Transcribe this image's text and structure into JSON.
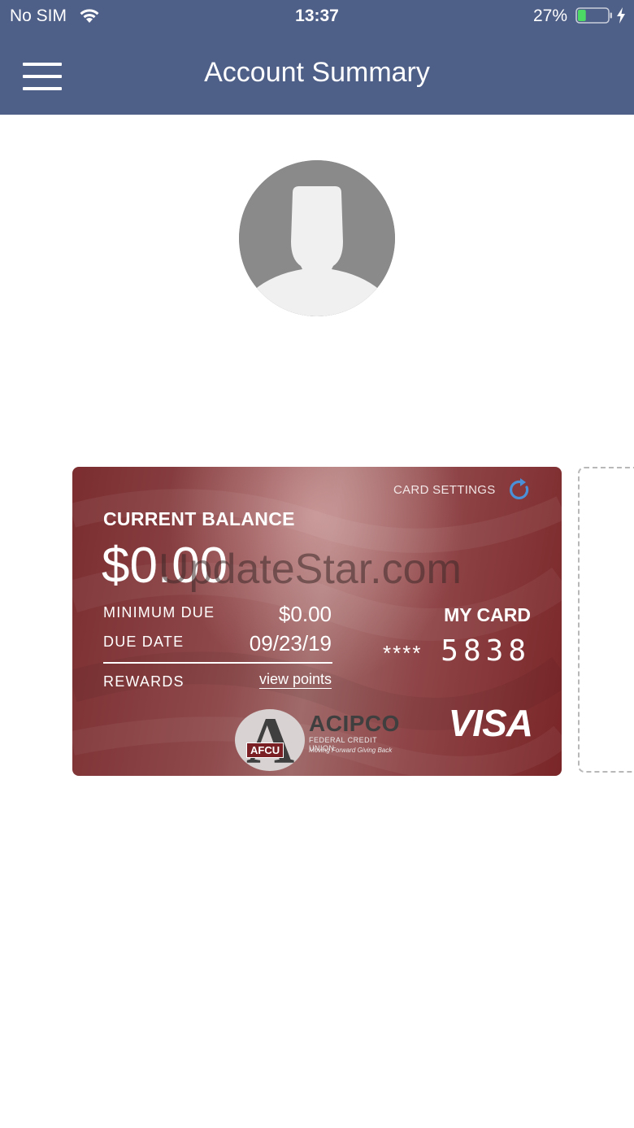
{
  "status_bar": {
    "carrier": "No SIM",
    "time": "13:37",
    "battery_percent": "27%",
    "battery_level": 0.27,
    "battery_color": "#4cd964"
  },
  "header": {
    "title": "Account Summary",
    "menu_icon": "hamburger-icon",
    "background": "#4e5f88"
  },
  "profile": {
    "avatar_icon": "person-silhouette-icon"
  },
  "card": {
    "settings_label": "CARD SETTINGS",
    "refresh_icon": "refresh-icon",
    "refresh_color": "#4a90d9",
    "current_balance_label": "CURRENT BALANCE",
    "current_balance": "$0.00",
    "minimum_due_label": "MINIMUM DUE",
    "minimum_due": "$0.00",
    "due_date_label": "DUE DATE",
    "due_date": "09/23/19",
    "rewards_label": "REWARDS",
    "rewards_link": "view points",
    "my_card_label": "MY CARD",
    "card_number_mask": "****",
    "card_last4": "5838",
    "network": "VISA",
    "issuer_logo": {
      "badge": "AFCU",
      "name": "ACIPCO",
      "subtitle": "FEDERAL CREDIT UNION",
      "tagline": "Moving Forward Giving Back"
    },
    "color": "#7b2d2f"
  },
  "watermark": "UpdateStar.com"
}
